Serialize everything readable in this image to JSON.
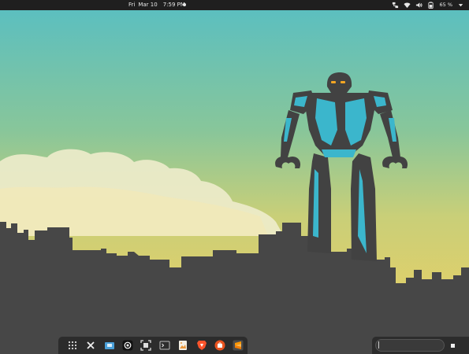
{
  "topbar": {
    "day": "Fri",
    "date": "Mar 10",
    "time": "7:59 PM",
    "battery_percent": "65 %"
  },
  "tray_icons": [
    "network-switch-icon",
    "wifi-icon",
    "volume-icon",
    "battery-icon",
    "chevron-down-icon"
  ],
  "dock": {
    "items": [
      {
        "name": "app-grid-icon"
      },
      {
        "name": "close-x-icon"
      },
      {
        "name": "files-icon"
      },
      {
        "name": "openai-icon"
      },
      {
        "name": "screenshot-icon"
      },
      {
        "name": "terminal-icon"
      },
      {
        "name": "image-viewer-icon"
      },
      {
        "name": "brave-browser-icon"
      },
      {
        "name": "ubuntu-software-icon"
      },
      {
        "name": "sublime-text-icon"
      }
    ]
  },
  "search": {
    "value": "",
    "placeholder": ""
  },
  "colors": {
    "topbar": "#1f1f1f",
    "sky_top": "#5cbfbf",
    "sky_bottom": "#f2d060",
    "cloud": "#eeeccc",
    "city": "#474747",
    "robot_body": "#424242",
    "robot_accent": "#3bb6cc",
    "robot_eyes": "#f5a623",
    "dock": "#2c2c2c"
  }
}
